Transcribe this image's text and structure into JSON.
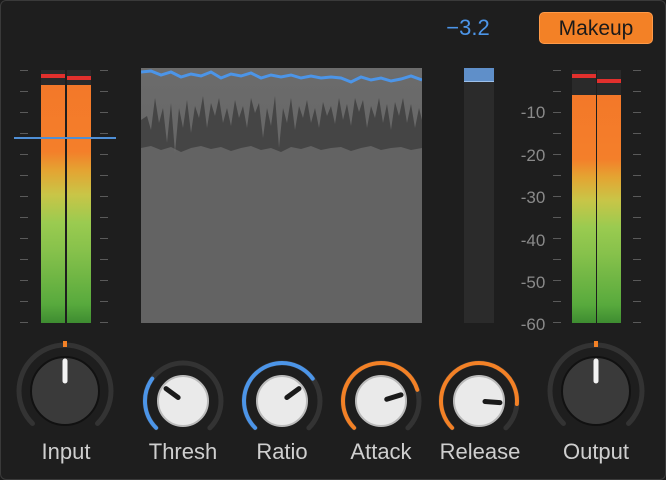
{
  "gain_reduction_readout": "−3.2",
  "makeup_button_label": "Makeup",
  "colors": {
    "accent_orange": "#f38126",
    "accent_blue": "#4c95e8",
    "peak_red": "#e2302d",
    "background": "#1e1e1e"
  },
  "scale": {
    "labels": [
      "-10",
      "-20",
      "-30",
      "-40",
      "-50",
      "-60"
    ]
  },
  "input_meters": {
    "left_level": 0.94,
    "right_level": 0.94,
    "left_peak": 0.97,
    "right_peak": 0.96
  },
  "output_meters": {
    "left_level": 0.9,
    "right_level": 0.9,
    "left_peak": 0.97,
    "right_peak": 0.95
  },
  "gain_reduction_level": 0.05,
  "knobs": [
    {
      "id": "input",
      "label": "Input",
      "value": 0.5,
      "style": "large",
      "arc": "none"
    },
    {
      "id": "thresh",
      "label": "Thresh",
      "value": 0.3,
      "style": "small",
      "arc": "blue"
    },
    {
      "id": "ratio",
      "label": "Ratio",
      "value": 0.7,
      "style": "small",
      "arc": "blue"
    },
    {
      "id": "attack",
      "label": "Attack",
      "value": 0.77,
      "style": "small",
      "arc": "orange"
    },
    {
      "id": "release",
      "label": "Release",
      "value": 0.85,
      "style": "small",
      "arc": "orange"
    },
    {
      "id": "output",
      "label": "Output",
      "value": 0.5,
      "style": "large",
      "arc": "none"
    }
  ]
}
